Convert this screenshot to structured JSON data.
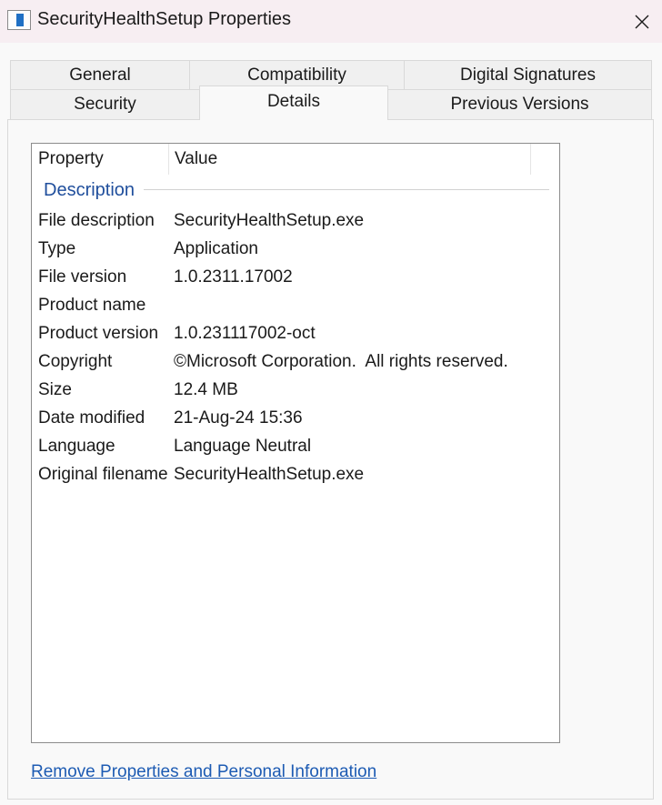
{
  "window": {
    "title": "SecurityHealthSetup Properties",
    "app_icon": "properties-window-icon",
    "close_icon": "close-icon"
  },
  "tabs": {
    "row_back": [
      {
        "label": "General"
      },
      {
        "label": "Compatibility"
      },
      {
        "label": "Digital Signatures"
      }
    ],
    "row_front": [
      {
        "label": "Security"
      },
      {
        "label": "Details"
      },
      {
        "label": "Previous Versions"
      }
    ],
    "selected": "Details"
  },
  "details": {
    "columns": {
      "property": "Property",
      "value": "Value"
    },
    "group": "Description",
    "rows": [
      {
        "property": "File description",
        "value": "SecurityHealthSetup.exe"
      },
      {
        "property": "Type",
        "value": "Application"
      },
      {
        "property": "File version",
        "value": "1.0.2311.17002"
      },
      {
        "property": "Product name",
        "value": ""
      },
      {
        "property": "Product version",
        "value": "1.0.231117002-oct"
      },
      {
        "property": "Copyright",
        "value": "©Microsoft Corporation.  All rights reserved."
      },
      {
        "property": "Size",
        "value": "12.4 MB"
      },
      {
        "property": "Date modified",
        "value": "21-Aug-24 15:36"
      },
      {
        "property": "Language",
        "value": "Language Neutral"
      },
      {
        "property": "Original filename",
        "value": "SecurityHealthSetup.exe"
      }
    ]
  },
  "footer": {
    "remove_link": "Remove Properties and Personal Information"
  }
}
